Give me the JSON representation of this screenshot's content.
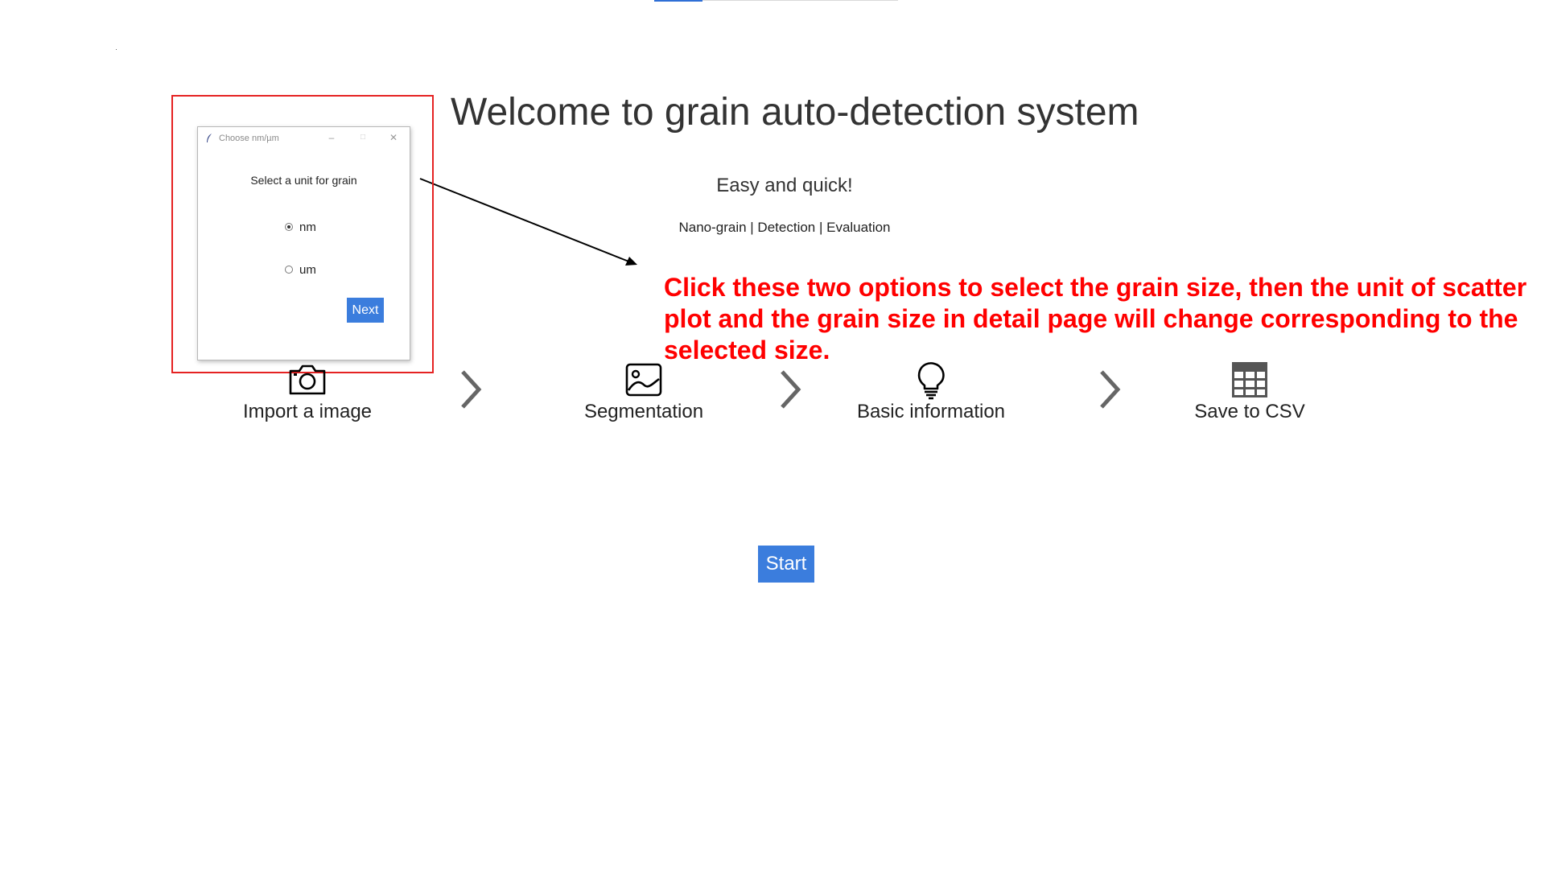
{
  "header": {
    "title": "Welcome to grain auto-detection system",
    "subtitle": "Easy and quick!",
    "tagline": "Nano-grain  |  Detection  |  Evaluation"
  },
  "annotation": {
    "text": "Click these two options to select the grain size, then the unit of scatter plot and the grain size in detail page will change corresponding to the selected size.",
    "color": "#ff0000",
    "box_color": "#e52222"
  },
  "dialog": {
    "title": "Choose nm/µm",
    "prompt": "Select a unit for grain",
    "options": [
      {
        "label": "nm",
        "selected": true
      },
      {
        "label": "um",
        "selected": false
      }
    ],
    "next_label": "Next",
    "controls": {
      "minimize": "–",
      "maximize": "□",
      "close": "✕"
    }
  },
  "steps": [
    {
      "label": "Import a image",
      "icon": "camera-icon"
    },
    {
      "label": "Segmentation",
      "icon": "image-icon"
    },
    {
      "label": "Basic information",
      "icon": "lightbulb-icon"
    },
    {
      "label": "Save to CSV",
      "icon": "table-icon"
    }
  ],
  "start_label": "Start",
  "colors": {
    "accent": "#3b7ddd",
    "text": "#333333"
  }
}
